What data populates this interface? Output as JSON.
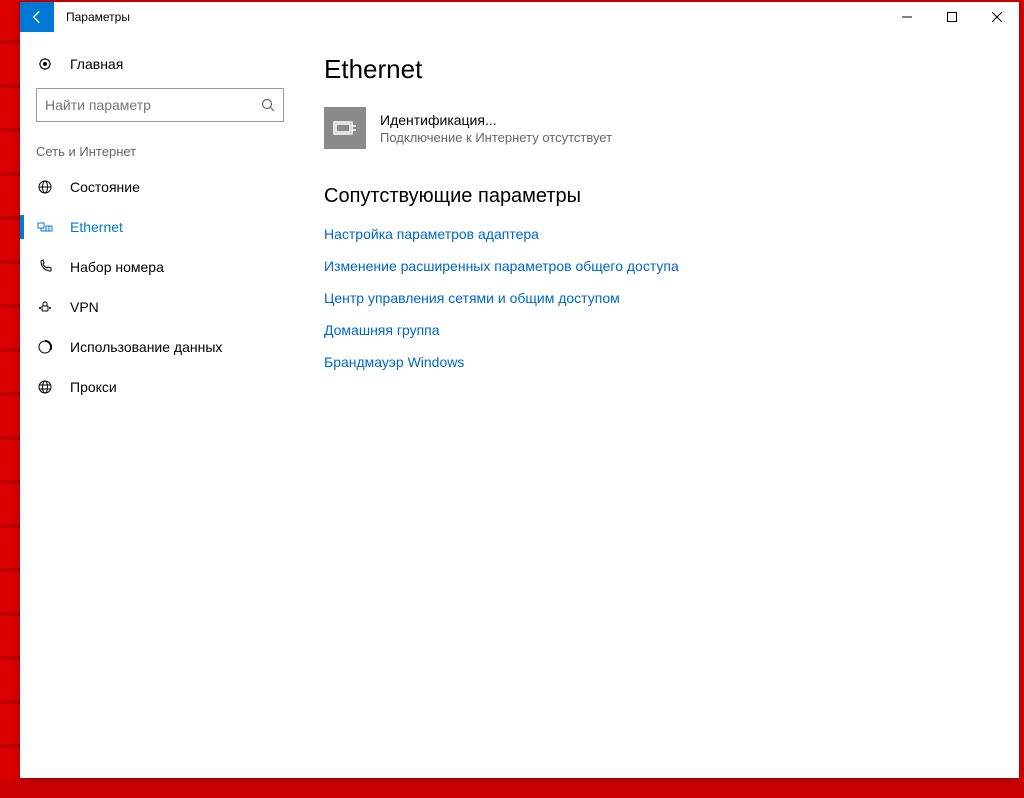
{
  "window": {
    "title": "Параметры"
  },
  "sidebar": {
    "home": "Главная",
    "search_placeholder": "Найти параметр",
    "section": "Сеть и Интернет",
    "items": [
      {
        "label": "Состояние"
      },
      {
        "label": "Ethernet"
      },
      {
        "label": "Набор номера"
      },
      {
        "label": "VPN"
      },
      {
        "label": "Использование данных"
      },
      {
        "label": "Прокси"
      }
    ]
  },
  "main": {
    "heading": "Ethernet",
    "network": {
      "name": "Идентификация...",
      "status": "Подключение к Интернету отсутствует"
    },
    "related_heading": "Сопутствующие параметры",
    "links": [
      "Настройка параметров адаптера",
      "Изменение расширенных параметров общего доступа",
      "Центр управления сетями и общим доступом",
      "Домашняя группа",
      "Брандмауэр Windows"
    ]
  }
}
